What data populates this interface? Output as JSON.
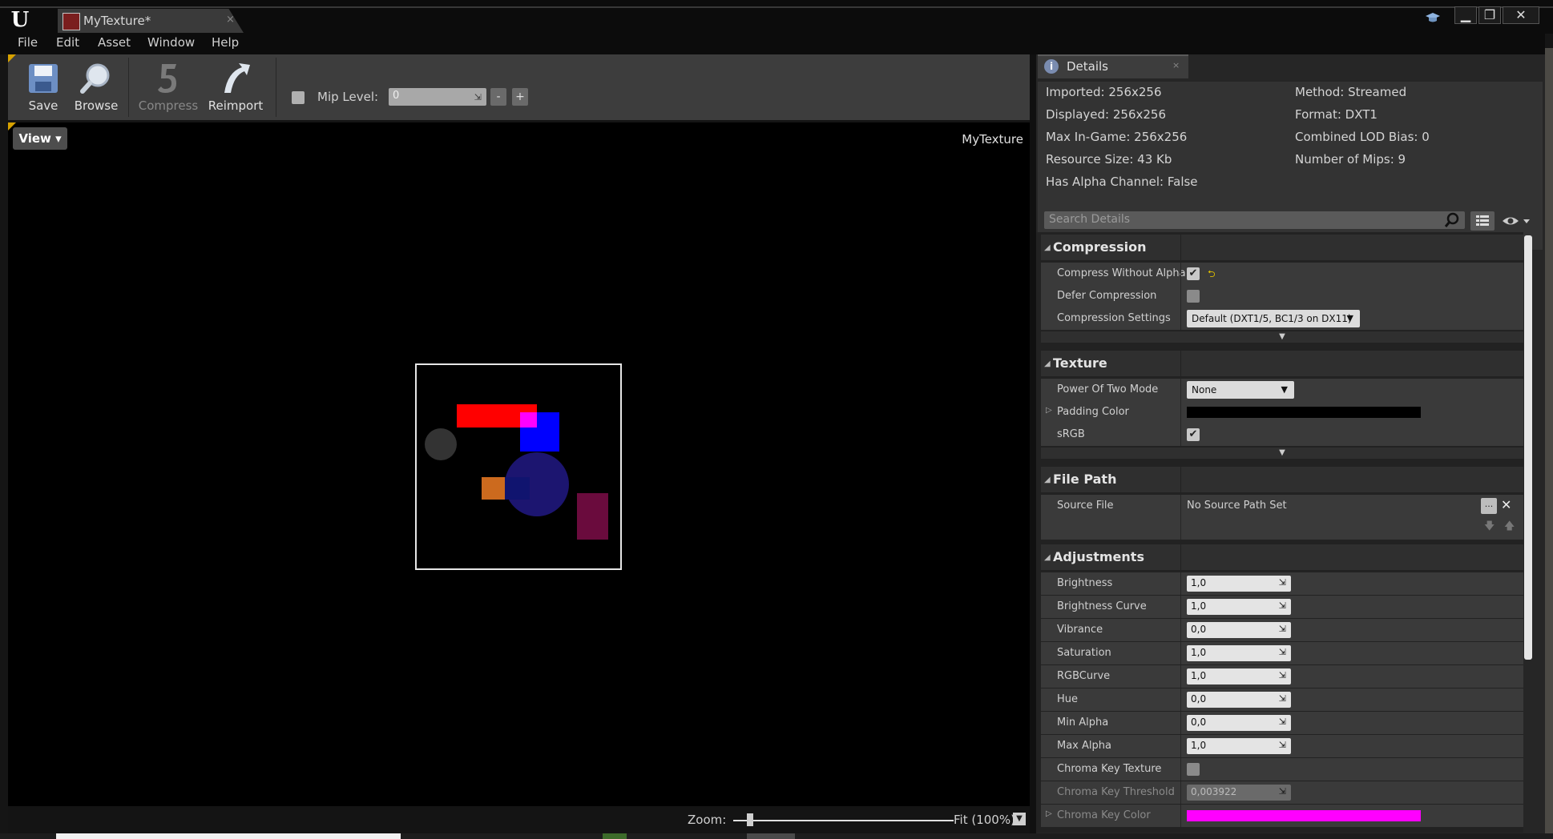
{
  "window": {
    "tab_title": "MyTexture*",
    "tab_close": "×",
    "controls": [
      "▁",
      "❐",
      "✕"
    ]
  },
  "menu": [
    "File",
    "Edit",
    "Asset",
    "Window",
    "Help"
  ],
  "toolbar": {
    "save": "Save",
    "browse": "Browse",
    "compress": "Compress",
    "reimport": "Reimport",
    "mip_label": "Mip Level:",
    "mip_value": "0",
    "mip_minus": "-",
    "mip_plus": "+"
  },
  "viewport": {
    "view_button": "View",
    "label": "MyTexture",
    "zoom_label": "Zoom:",
    "zoom_fit": "Fit (100%)"
  },
  "details": {
    "tab": "Details",
    "tab_close": "×",
    "info_left": [
      "Imported: 256x256",
      "Displayed: 256x256",
      "Max In-Game: 256x256",
      "Resource Size: 43 Kb",
      "Has Alpha Channel: False"
    ],
    "info_right": [
      "Method: Streamed",
      "Format: DXT1",
      "Combined LOD Bias: 0",
      "Number of Mips: 9"
    ],
    "search_placeholder": "Search Details",
    "compression": {
      "title": "Compression",
      "compress_without_alpha": "Compress Without Alpha",
      "defer_compression": "Defer Compression",
      "compression_settings": "Compression Settings",
      "compression_settings_value": "Default (DXT1/5, BC1/3 on DX11)"
    },
    "texture": {
      "title": "Texture",
      "power_of_two_mode": "Power Of Two Mode",
      "power_of_two_value": "None",
      "padding_color": "Padding Color",
      "srgb": "sRGB"
    },
    "file_path": {
      "title": "File Path",
      "source_file": "Source File",
      "source_value": "No Source Path Set",
      "browse_btn": "..."
    },
    "adjustments": {
      "title": "Adjustments",
      "rows": [
        {
          "label": "Brightness",
          "value": "1,0"
        },
        {
          "label": "Brightness Curve",
          "value": "1,0"
        },
        {
          "label": "Vibrance",
          "value": "0,0"
        },
        {
          "label": "Saturation",
          "value": "1,0"
        },
        {
          "label": "RGBCurve",
          "value": "1,0"
        },
        {
          "label": "Hue",
          "value": "0,0"
        },
        {
          "label": "Min Alpha",
          "value": "0,0"
        },
        {
          "label": "Max Alpha",
          "value": "1,0"
        }
      ],
      "chroma_key_texture": "Chroma Key Texture",
      "chroma_key_threshold": "Chroma Key Threshold",
      "chroma_key_threshold_value": "0,003922",
      "chroma_key_color": "Chroma Key Color"
    }
  },
  "colors": {
    "accent": "#d6a100",
    "padding_color": "#000000",
    "chroma_key_color": "#ff00ff"
  }
}
